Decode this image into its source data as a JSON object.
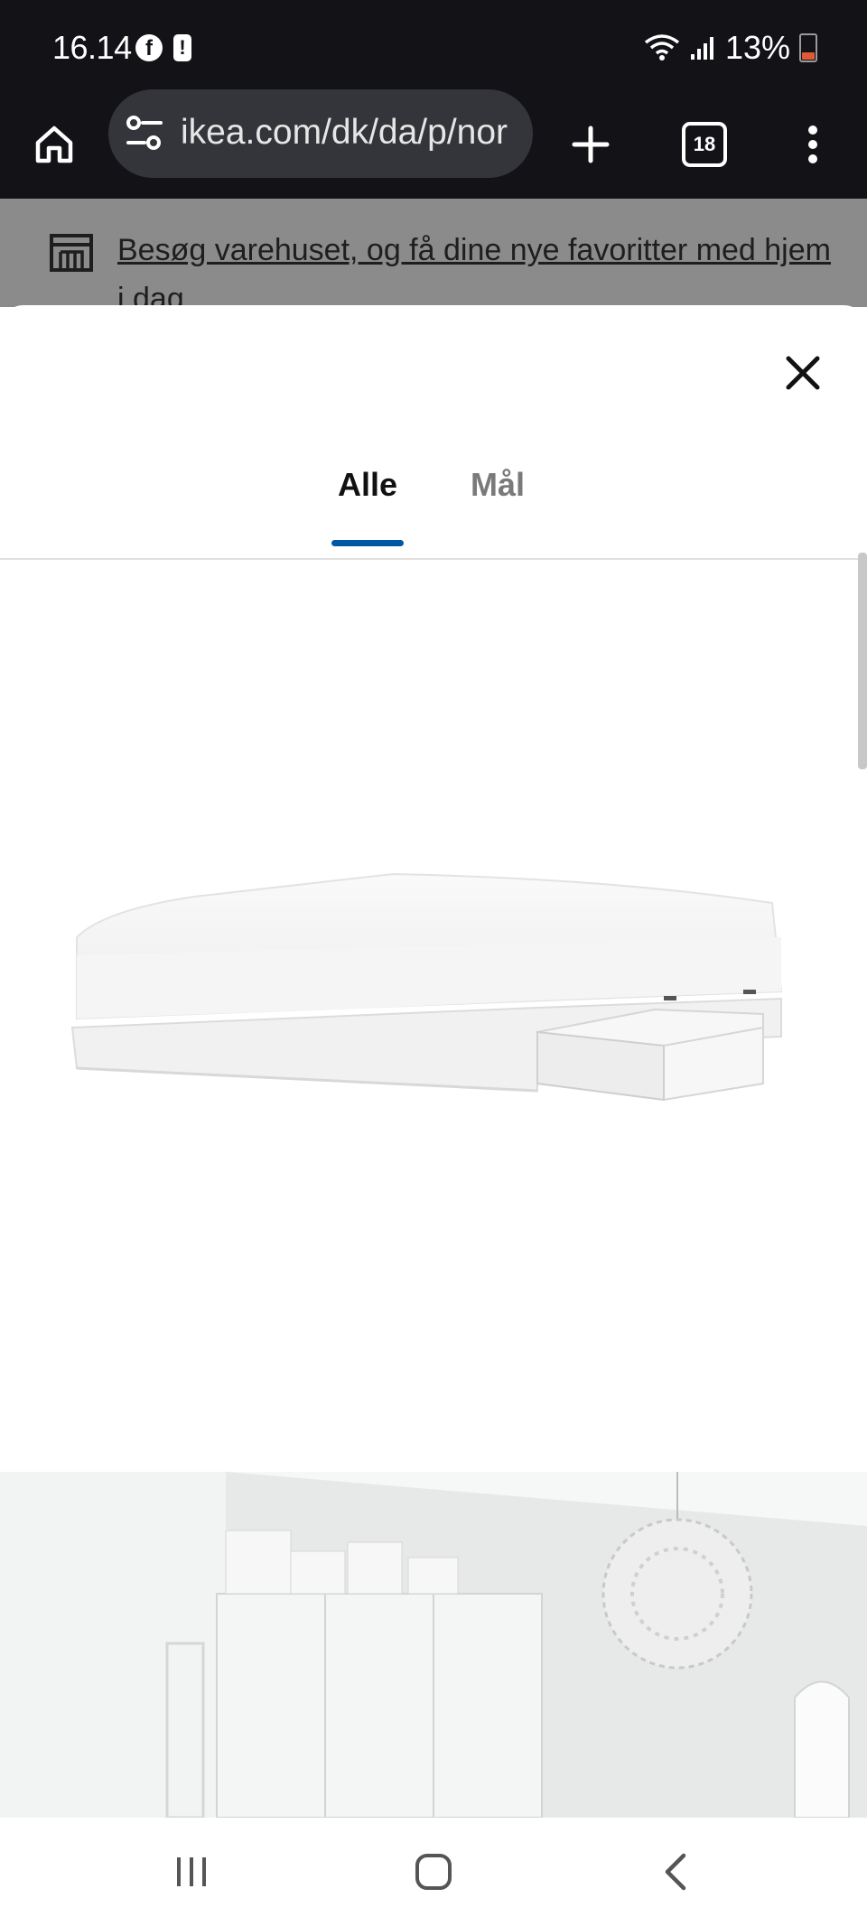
{
  "status_bar": {
    "time": "16.14",
    "battery": "13%",
    "icons": [
      "facebook-icon",
      "alert-icon",
      "wifi-icon",
      "signal-icon",
      "battery-icon"
    ]
  },
  "browser": {
    "url": "ikea.com/dk/da/p/nor",
    "tab_count": "18",
    "icons": [
      "home-icon",
      "tune-icon",
      "new-tab-icon",
      "tabs-icon",
      "more-icon"
    ]
  },
  "background_page": {
    "banner_text": "Besøg varehuset, og få dine nye favoritter med hjem i dag"
  },
  "modal": {
    "tabs": [
      {
        "label": "Alle",
        "selected": true
      },
      {
        "label": "Mål",
        "selected": false
      }
    ],
    "accent_color": "#0058a3"
  },
  "nav_bar": {
    "icons": [
      "recents-icon",
      "home-nav-icon",
      "back-icon"
    ]
  }
}
